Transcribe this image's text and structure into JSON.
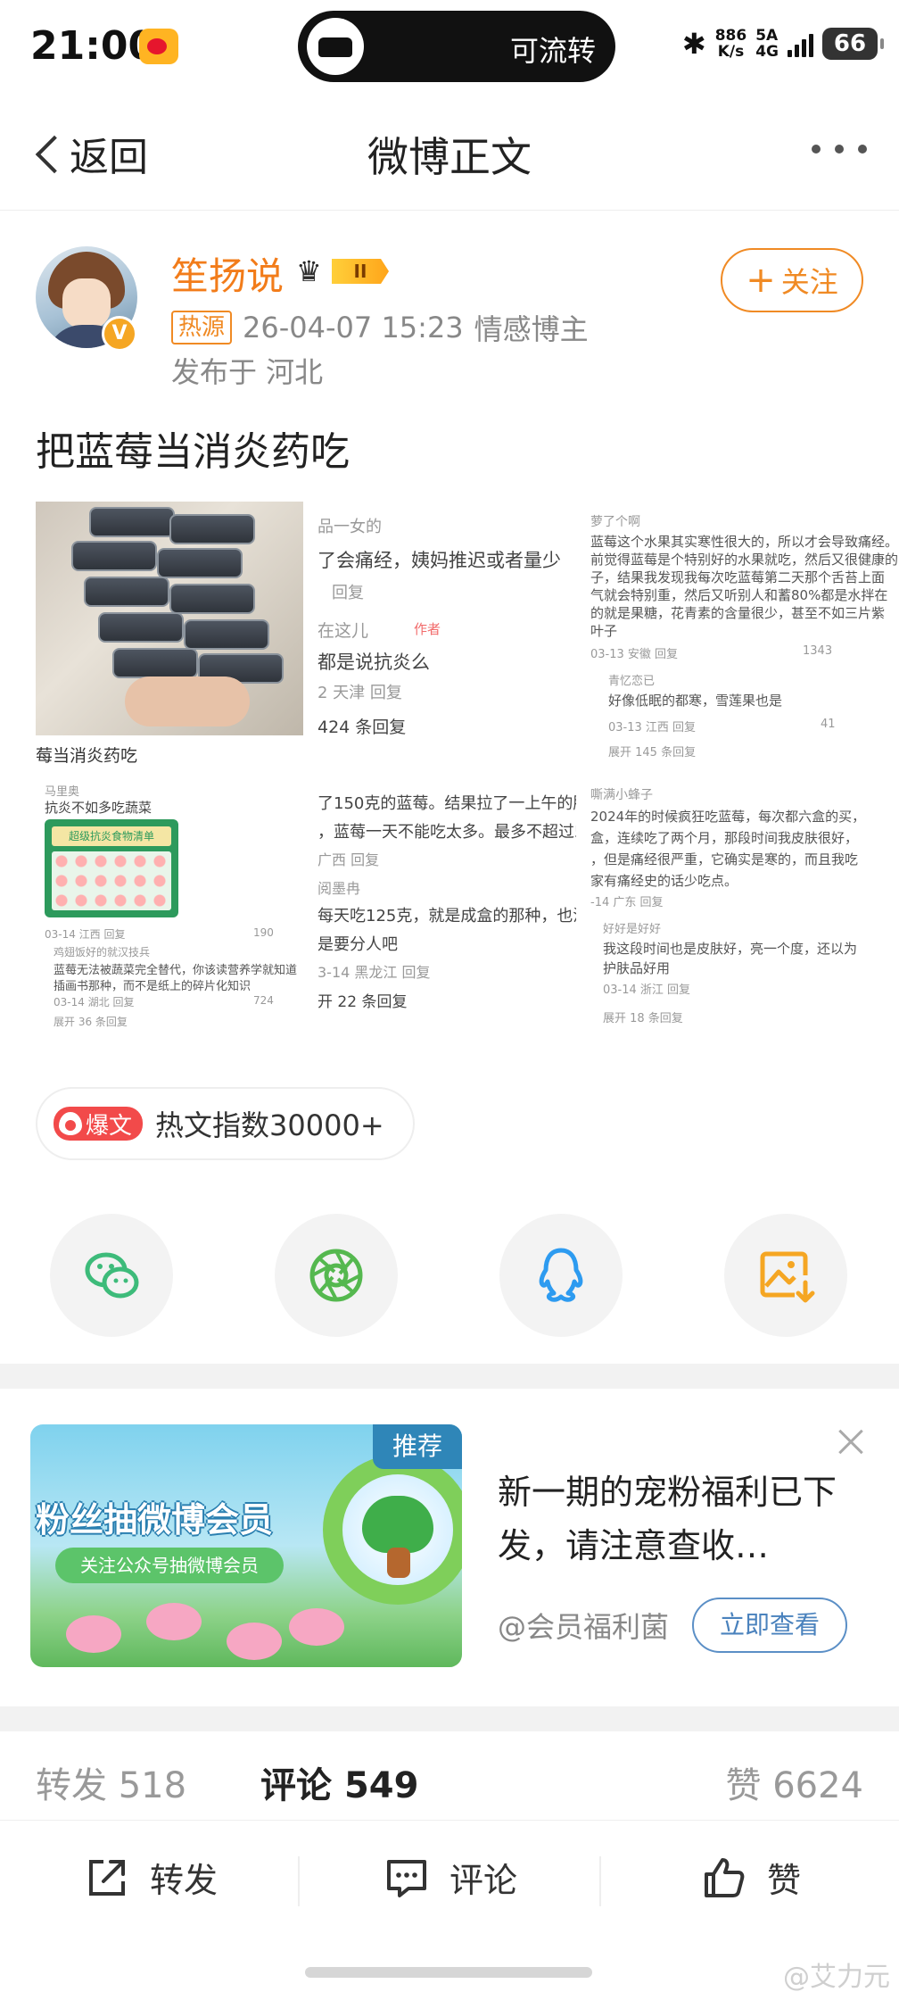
{
  "status_bar": {
    "time": "21:00",
    "island_label": "可流转",
    "bluetooth": "✱",
    "speed_value": "886",
    "speed_unit": "K/s",
    "network_top": "5A",
    "network_bottom": "4G",
    "battery": "66"
  },
  "nav": {
    "back_label": "返回",
    "title": "微博正文"
  },
  "author": {
    "name": "笙扬说",
    "level": "II",
    "hot_tag": "热源",
    "timestamp": "26-04-07 15:23",
    "category": "情感博主",
    "location": "发布于 河北",
    "follow_label": "关注",
    "verified_mark": "V"
  },
  "post": {
    "text": "把蓝莓当消炎药吃",
    "collage": {
      "photo_caption": "莓当消炎药吃",
      "c1": [
        "品一女的",
        "了会痛经，姨妈推迟或者量少",
        "回复",
        "在这儿",
        "作者",
        "都是说抗炎么",
        "2 天津  回复",
        "424 条回复"
      ],
      "c2": [
        "萝了个啊",
        "蓝莓这个水果其实寒性很大的，所以才会导致痛经。",
        "前觉得蓝莓是个特别好的水果就吃，然后又很健康的",
        "子，结果我发现我每次吃蓝莓第二天那个舌苔上面",
        "气就会特别重，然后又听别人和蓄80%都是水拌在",
        "的就是果糖，花青素的含量很少，甚至不如三片紫",
        "叶子",
        "03-13 安徽  回复",
        "1343",
        "青忆恋已",
        "好像低眠的都寒，雪莲果也是",
        "03-13 江西  回复",
        "41",
        "展开 145 条回复"
      ],
      "c3": [
        "马里奥",
        "抗炎不如多吃蔬菜",
        "超级抗炎食物清单",
        "03-14 江西  回复",
        "190",
        "鸡翅饭好的就汉技兵",
        "蓝莓无法被蔬菜完全替代，你该读营养学就知道",
        "插画书那种，而不是纸上的碎片化知识",
        "03-14 湖北  回复",
        "724",
        "展开 36 条回复"
      ],
      "c4": [
        "了150克的蓝莓。结果拉了一上午的肚",
        "，蓝莓一天不能吃太多。最多不超过50",
        "广西  回复",
        "阅墨冉",
        "每天吃125克，就是成盒的那种，也没",
        "是要分人吧",
        "3-14 黑龙江  回复",
        "开 22 条回复"
      ],
      "c5": [
        "嘶满小蜂子",
        "2024年的时候疯狂吃蓝莓，每次都六盒的买，",
        "盒，连续吃了两个月，那段时间我皮肤很好，",
        "，但是痛经很严重，它确实是寒的，而且我吃",
        "家有痛经史的话少吃点。",
        "-14 广东  回复",
        "好好是好好",
        "我这段时间也是皮肤好，亮一个度，还以为",
        "护肤品好用",
        "03-14 浙江  回复",
        "展开 18 条回复"
      ]
    }
  },
  "hot_index": {
    "badge": "爆文",
    "text": "热文指数30000+"
  },
  "share": [
    {
      "name": "wechat",
      "icon": "wechat-icon",
      "color": "#3dbb7a"
    },
    {
      "name": "moments",
      "icon": "moments-icon",
      "color": "#55b84f"
    },
    {
      "name": "qq",
      "icon": "qq-icon",
      "color": "#2d9bf0"
    },
    {
      "name": "save-image",
      "icon": "save-image-icon",
      "color": "#f5a623"
    }
  ],
  "ad": {
    "recommend_tag": "推荐",
    "image_title": "粉丝抽微博会员",
    "image_subtitle": "关注公众号抽微博会员",
    "headline": "新一期的宠粉福利已下发，请注意查收…",
    "account": "@会员福利菌",
    "button": "立即查看"
  },
  "stats": {
    "repost_label": "转发",
    "repost_count": "518",
    "comment_label": "评论",
    "comment_count": "549",
    "like_label": "赞",
    "like_count": "6624"
  },
  "actions": {
    "repost": "转发",
    "comment": "评论",
    "like": "赞"
  },
  "watermark": "@艾力元"
}
